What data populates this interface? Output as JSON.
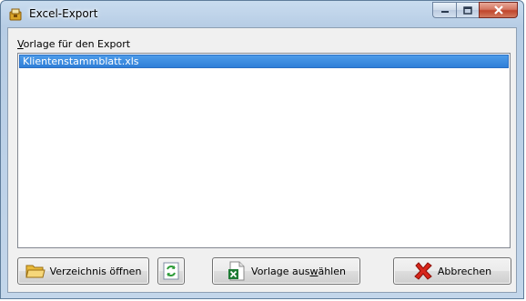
{
  "window": {
    "title": "Excel-Export",
    "icon": "excel-export-app-icon"
  },
  "caption_buttons": {
    "minimize_icon": "minimize-icon",
    "maximize_icon": "maximize-icon",
    "close_icon": "close-icon"
  },
  "template_group": {
    "label_accel": "V",
    "label_rest": "orlage für den Export",
    "items": [
      {
        "label": "Klientenstammblatt.xls",
        "selected": true
      }
    ]
  },
  "buttons": {
    "open_directory": {
      "label": "Verzeichnis öffnen",
      "icon": "folder-icon"
    },
    "refresh": {
      "icon": "refresh-icon"
    },
    "select_template": {
      "label_pre": "Vorlage aus",
      "label_accel": "w",
      "label_post": "ählen",
      "icon": "excel-file-icon"
    },
    "cancel": {
      "label": "Abbrechen",
      "icon": "red-x-icon"
    }
  },
  "colors": {
    "selection": "#3284dc",
    "title_gradient": "#b7cde5",
    "close_button": "#c0452b"
  }
}
